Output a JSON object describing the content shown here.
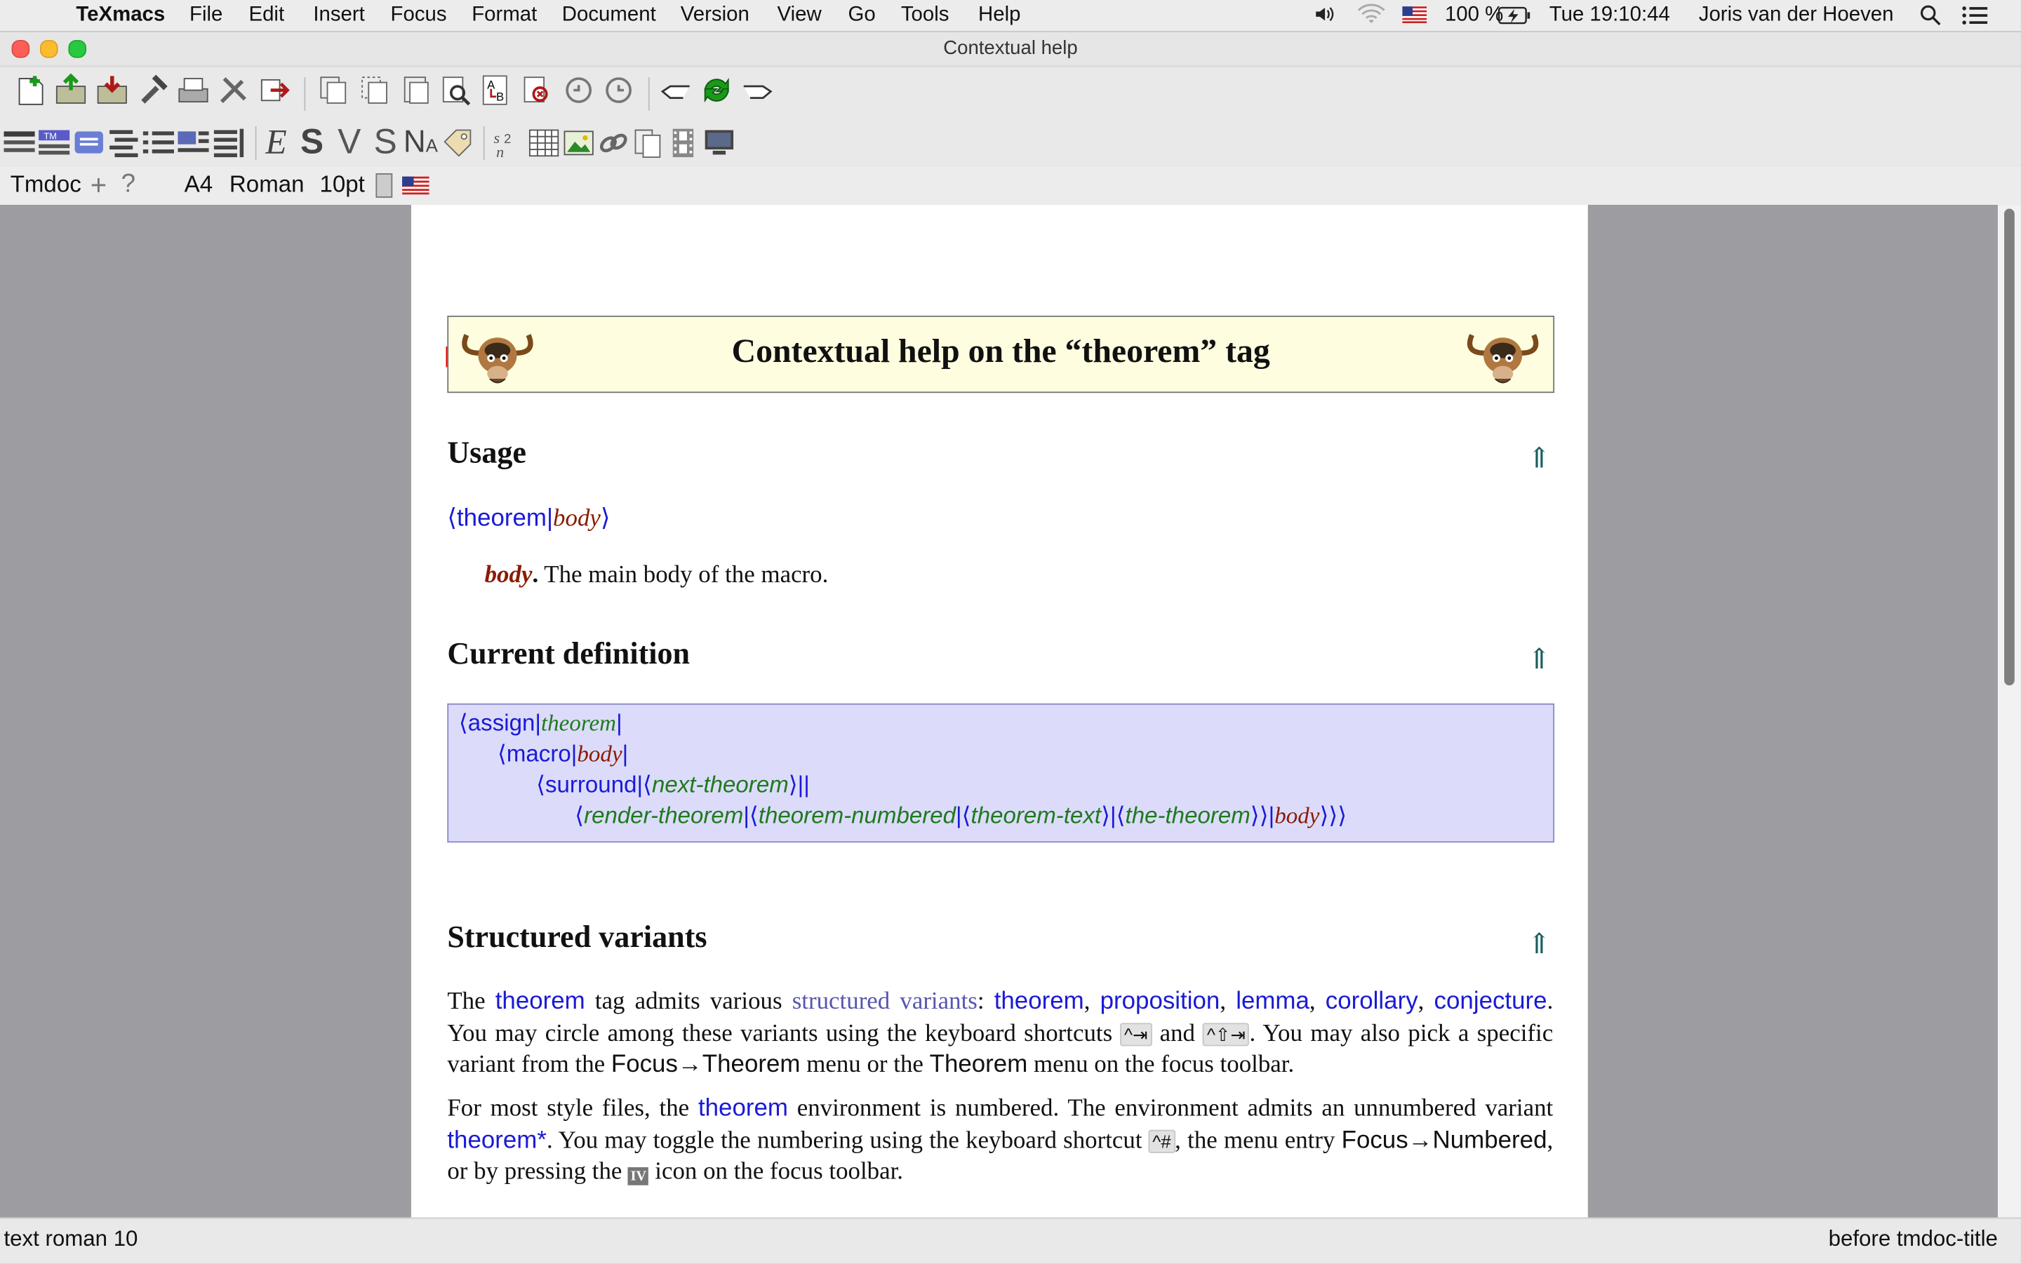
{
  "menubar": {
    "app": "TeXmacs",
    "items": [
      "File",
      "Edit",
      "Insert",
      "Focus",
      "Format",
      "Document",
      "Version",
      "View",
      "Go",
      "Tools",
      "Help"
    ],
    "battery": "100 %",
    "clock": "Tue 19:10:44",
    "user": "Joris van der Hoeven"
  },
  "window": {
    "title": "Contextual help"
  },
  "focusbar": {
    "style": "Tmdoc",
    "plus": "+",
    "help": "?",
    "paper": "A4",
    "font": "Roman",
    "size": "10pt"
  },
  "document": {
    "title": "Contextual help on the “theorem” tag",
    "usage": {
      "heading": "Usage",
      "open": "⟨",
      "close": "⟩",
      "sep": "|",
      "tag": "theorem",
      "arg": "body",
      "body_name": "body",
      "dot": ".",
      "body_desc": "The main body of the macro."
    },
    "definition": {
      "heading": "Current definition",
      "assign": "assign",
      "theorem": "theorem",
      "macro": "macro",
      "body": "body",
      "surround": "surround",
      "next_theorem": "next-theorem",
      "render_theorem": "render-theorem",
      "theorem_numbered": "theorem-numbered",
      "theorem_text": "theorem-text",
      "the_theorem": "the-theorem",
      "close3": "⟩⟩⟩"
    },
    "variants": {
      "heading": "Structured variants",
      "p1_a": "The ",
      "p1_tag": "theorem",
      "p1_b": " tag admits various ",
      "p1_link": "structured variants",
      "p1_c": ": ",
      "v1": "theorem",
      "v2": "proposition",
      "v3": "lemma",
      "v4": "corollary",
      "v5": "conjecture",
      "comma": ", ",
      "p1_d": ". You may circle among these variants using the keyboard shortcuts ",
      "kbd1": "^⇥",
      "and": " and ",
      "kbd2": "^⇧⇥",
      "p1_e": ". You may also pick a specific variant from the ",
      "menu_focus_theorem": "Focus→Theorem",
      "p1_f": " menu or the ",
      "menu_theorem": "Theorem",
      "p1_g": " menu on the focus toolbar.",
      "p2_a": "For most style files, the ",
      "p2_tag": "theorem",
      "p2_b": " environment is numbered. The environment admits an unnumbered variant ",
      "p2_tag2": "theorem*",
      "p2_c": ". You may toggle the numbering using the keyboard shortcut ",
      "kbd3": "^#",
      "p2_d": ", the menu entry ",
      "menu_focus_numbered": "Focus→Numbered",
      "p2_e": ", or by pressing the ",
      "p2_f": " icon on the focus toolbar."
    }
  },
  "status": {
    "left": "text roman 10",
    "right": "before tmdoc-title"
  },
  "colors": {
    "tag": "#1a1ad6",
    "arg": "#8b1a00",
    "var": "#1f7a1f",
    "titlebox": "#fffde0",
    "defbox": "#dcdcfa"
  }
}
